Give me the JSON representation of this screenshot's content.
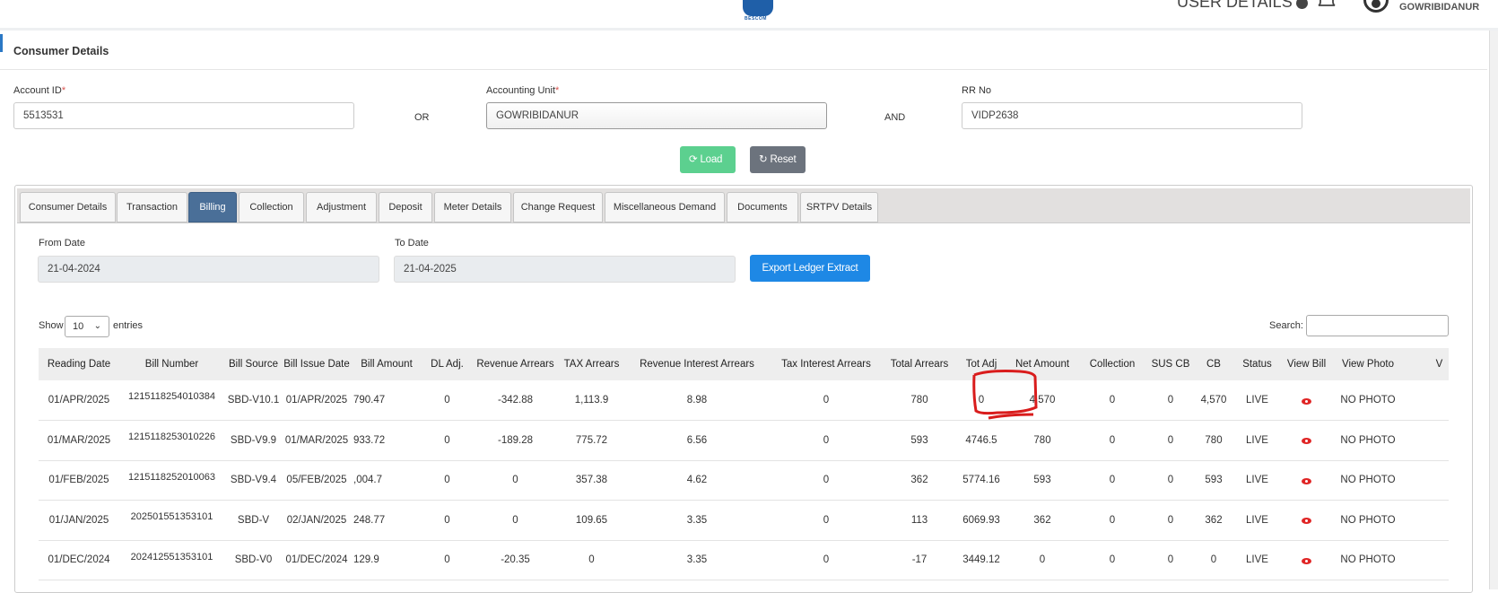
{
  "header": {
    "logo_text": "BESCOM",
    "user_details_label": "USER DETAILS",
    "username": "GOWRIBIDANUR"
  },
  "card": {
    "title": "Consumer Details"
  },
  "form": {
    "account_id": {
      "label": "Account ID",
      "required": "*",
      "value": "5513531"
    },
    "or_label": "OR",
    "accounting_unit": {
      "label": "Accounting Unit",
      "required": "*",
      "value": "GOWRIBIDANUR"
    },
    "and_label": "AND",
    "rr_no": {
      "label": "RR No",
      "value": "VIDP2638"
    },
    "load_label": "Load",
    "reset_label": "Reset"
  },
  "tabs": [
    {
      "label": "Consumer Details"
    },
    {
      "label": "Transaction"
    },
    {
      "label": "Billing"
    },
    {
      "label": "Collection"
    },
    {
      "label": "Adjustment"
    },
    {
      "label": "Deposit"
    },
    {
      "label": "Meter Details"
    },
    {
      "label": "Change Request"
    },
    {
      "label": "Miscellaneous Demand"
    },
    {
      "label": "Documents"
    },
    {
      "label": "SRTPV Details"
    }
  ],
  "active_tab": "Billing",
  "billing": {
    "from_date": {
      "label": "From Date",
      "value": "21-04-2024"
    },
    "to_date": {
      "label": "To Date",
      "value": "21-04-2025"
    },
    "export_label": "Export Ledger Extract",
    "show_label": "Show",
    "page_length": "10",
    "entries_label": "entries",
    "search_label": "Search:"
  },
  "table": {
    "columns": [
      "Reading Date",
      "Bill Number",
      "Bill Source",
      "Bill Issue Date",
      "Bill Amount",
      "DL Adj.",
      "Revenue Arrears",
      "TAX Arrears",
      "Revenue Interest Arrears",
      "Tax Interest Arrears",
      "Total Arrears",
      "Tot Adj",
      "Net Amount",
      "Collection",
      "SUS CB",
      "CB",
      "Status",
      "View Bill",
      "View Photo",
      "V"
    ],
    "rows": [
      [
        "01/APR/2025",
        "1215118254010384",
        "SBD-V10.1",
        "01/APR/2025",
        "790.47",
        "0",
        "-342.88",
        "1,113.9",
        "8.98",
        "0",
        "780",
        "0",
        "4,570",
        "0",
        "0",
        "4,570",
        "LIVE",
        "",
        "NO PHOTO",
        ""
      ],
      [
        "01/MAR/2025",
        "1215118253010226",
        "SBD-V9.9",
        "01/MAR/2025",
        "933.72",
        "0",
        "-189.28",
        "775.72",
        "6.56",
        "0",
        "593",
        "4746.5",
        "780",
        "0",
        "0",
        "780",
        "LIVE",
        "",
        "NO PHOTO",
        ""
      ],
      [
        "01/FEB/2025",
        "1215118252010063",
        "SBD-V9.4",
        "05/FEB/2025",
        ",004.7",
        "0",
        "0",
        "357.38",
        "4.62",
        "0",
        "362",
        "5774.16",
        "593",
        "0",
        "0",
        "593",
        "LIVE",
        "",
        "NO PHOTO",
        ""
      ],
      [
        "01/JAN/2025",
        "202501551353101",
        "SBD-V",
        "02/JAN/2025",
        "248.77",
        "0",
        "0",
        "109.65",
        "3.35",
        "0",
        "113",
        "6069.93",
        "362",
        "0",
        "0",
        "362",
        "LIVE",
        "",
        "NO PHOTO",
        ""
      ],
      [
        "01/DEC/2024",
        "202412551353101",
        "SBD-V0",
        "01/DEC/2024",
        "129.9",
        "0",
        "-20.35",
        "0",
        "3.35",
        "0",
        "-17",
        "3449.12",
        "0",
        "0",
        "0",
        "0",
        "LIVE",
        "",
        "NO PHOTO",
        ""
      ]
    ]
  },
  "colors": {
    "active_tab": "#4a6f98",
    "load_button": "#5cd08f",
    "reset_button": "#6c737d",
    "export_button": "#1e88e5",
    "annotation": "#d91c1c",
    "view_bill_icon": "#e02424"
  },
  "icons": {
    "load": "spinner-icon",
    "reset": "refresh-icon",
    "view_bill": "eye-icon",
    "notifications": "bell-icon",
    "user": "user-avatar-icon"
  }
}
